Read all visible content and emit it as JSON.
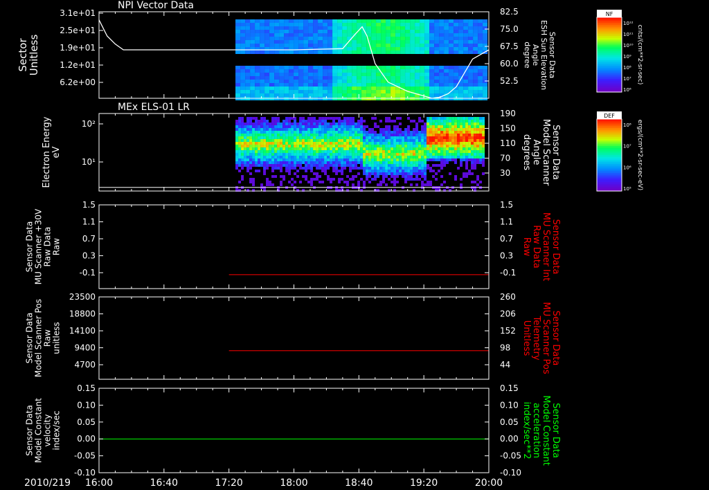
{
  "chart_data": [
    {
      "type": "heatmap",
      "title": "NPI Vector Data",
      "ylabel_left": [
        "Sector",
        "Unitless"
      ],
      "yticks_left": [
        "3.1e+01",
        "2.5e+01",
        "1.9e+01",
        "1.2e+01",
        "6.2e+00"
      ],
      "ylabel_right": [
        "Sensor Data",
        "ESH Sun Elevation",
        "Angle",
        "degree"
      ],
      "yticks_right": [
        "82.5",
        "75.0",
        "67.5",
        "60.0",
        "52.5"
      ],
      "yrange_right": [
        45,
        82.5
      ],
      "data_start_time": "17:24",
      "overlay_line": {
        "name": "ESH Sun Elevation Angle",
        "color": "#ffffff",
        "times": [
          "16:00",
          "16:05",
          "16:10",
          "16:15",
          "17:00",
          "18:00",
          "18:30",
          "18:38",
          "18:42",
          "18:45",
          "18:50",
          "18:58",
          "19:10",
          "19:20",
          "19:25",
          "19:30",
          "19:35",
          "19:40",
          "19:45",
          "19:50",
          "20:00"
        ],
        "values": [
          79,
          72,
          68.5,
          66,
          66,
          66,
          66.5,
          73,
          76,
          72,
          60,
          52,
          48,
          46,
          45,
          45.5,
          47,
          50,
          56,
          62,
          66
        ]
      },
      "colorbar": {
        "label": "NF",
        "units": "cnts/(cm**2-sr-sec)",
        "ticks": [
          "10¹²",
          "10¹¹",
          "10¹⁰",
          "10⁹",
          "10⁸",
          "10⁷",
          "10⁶"
        ]
      }
    },
    {
      "type": "heatmap",
      "title": "MEx ELS-01 LR",
      "ylabel_left": [
        "Electron Energy",
        "eV"
      ],
      "yticks_left": [
        "10²",
        "10¹"
      ],
      "ylabel_right": [
        "Sensor Data",
        "Model Scanner",
        "Angle",
        "degrees"
      ],
      "yticks_right": [
        "190",
        "150",
        "110",
        "70",
        "30"
      ],
      "yrange_right": [
        0,
        190
      ],
      "data_start_time": "17:24",
      "overlay_line": {
        "name": "Model Scanner Angle",
        "color": "#ffffff",
        "constant_value": 9
      },
      "colorbar": {
        "label": "DEF",
        "units": "ergs/(cm**2-sr-sec-eV)",
        "ticks": [
          "10⁸",
          "10⁷",
          "10⁶",
          "10⁵"
        ]
      }
    },
    {
      "type": "line",
      "ylabel_left": [
        "Sensor Data",
        "MU Scanner +30V",
        "Raw Data",
        "Raw"
      ],
      "yticks_left": [
        "1.5",
        "1.1",
        "0.7",
        "0.3",
        "-0.1"
      ],
      "ylabel_right": [
        "Sensor Data",
        "MU Scanner Int",
        "Raw Data",
        "Raw"
      ],
      "yticks_right": [
        "1.5",
        "1.1",
        "0.7",
        "0.3",
        "-0.1"
      ],
      "ylim": [
        -0.3,
        1.5
      ],
      "series": [
        {
          "color": "#ff0000",
          "x": [
            "17:20",
            "20:00"
          ],
          "values": [
            0,
            0
          ]
        }
      ]
    },
    {
      "type": "line",
      "ylabel_left": [
        "Sensor Data",
        "Model Scanner Pos",
        "Raw",
        "unitless"
      ],
      "yticks_left": [
        "23500",
        "18800",
        "14100",
        "9400",
        "4700"
      ],
      "ylim_left": [
        0,
        23500
      ],
      "ylabel_right": [
        "Sensor Data",
        "MU Scanner Pos",
        "Telemetry",
        "Unitless"
      ],
      "yticks_right": [
        "260",
        "206",
        "152",
        "98",
        "44"
      ],
      "ylim": [
        0,
        260
      ],
      "series": [
        {
          "color": "#ff0000",
          "x": [
            "17:20",
            "20:00"
          ],
          "values": [
            90,
            90
          ]
        }
      ]
    },
    {
      "type": "line",
      "ylabel_left": [
        "Sensor Data",
        "Model Constant",
        "velocity",
        "index/sec"
      ],
      "yticks_left": [
        "0.15",
        "0.10",
        "0.05",
        "0.00",
        "-0.05",
        "-0.10"
      ],
      "ylabel_right": [
        "Sensor Data",
        "Model Constant",
        "acceleration",
        "index/sec**2"
      ],
      "yticks_right": [
        "0.15",
        "0.10",
        "0.05",
        "0.00",
        "-0.05",
        "-0.10"
      ],
      "ylim": [
        -0.1,
        0.15
      ],
      "series": [
        {
          "color": "#00ff00",
          "x": [
            "16:00",
            "20:00"
          ],
          "values": [
            0,
            0
          ]
        }
      ]
    }
  ],
  "x_axis": {
    "date": "2010/219",
    "ticks": [
      "16:00",
      "16:40",
      "17:20",
      "18:00",
      "18:40",
      "19:20",
      "20:00"
    ],
    "range": [
      "16:00",
      "20:00"
    ]
  },
  "colors": {
    "background": "#000000",
    "axes": "#ffffff",
    "right_label_panel3": "#ff0000",
    "right_label_panel4": "#ff0000",
    "right_label_panel5": "#00ff00"
  }
}
